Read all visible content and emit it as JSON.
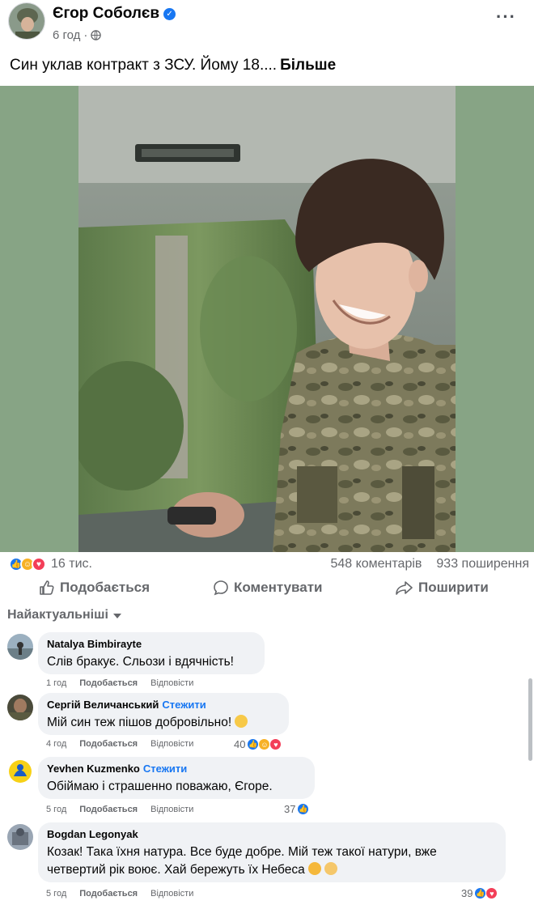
{
  "post": {
    "author": "Єгор Соболєв",
    "time": "6 год",
    "text": "Син уклав контракт з ЗСУ. Йому 18....",
    "see_more": "Більше"
  },
  "stats": {
    "reactions_count": "16 тис.",
    "comments": "548 коментарів",
    "shares": "933 поширення"
  },
  "actions": {
    "like": "Подобається",
    "comment": "Коментувати",
    "share": "Поширити"
  },
  "sort_label": "Найактуальніші",
  "comments": [
    {
      "name": "Natalya Bimbirayte",
      "follow": "",
      "text": "Слів бракує. Сльози і вдячність!",
      "time": "1 год",
      "like": "Подобається",
      "reply": "Відповісти",
      "reactions": ""
    },
    {
      "name": "Сергій Величанський",
      "follow": "Стежити",
      "text": "Мій син теж пішов добровільно!",
      "time": "4 год",
      "like": "Подобається",
      "reply": "Відповісти",
      "reactions": "40"
    },
    {
      "name": "Yevhen Kuzmenko",
      "follow": "Стежити",
      "text": "Обіймаю і страшенно поважаю, Єгоре.",
      "time": "5 год",
      "like": "Подобається",
      "reply": "Відповісти",
      "reactions": "37"
    },
    {
      "name": "Bogdan Legonyak",
      "follow": "",
      "text_line1": "Козак! Така їхня натура. Все буде добре. Мій теж такої натури, вже",
      "text_line2": "четвертий рік воює. Хай бережуть їх Небеса",
      "time": "5 год",
      "like": "Подобається",
      "reply": "Відповісти",
      "reactions": "39"
    }
  ],
  "colors": {
    "accent": "#1877f2",
    "secondary_text": "#65676b",
    "bubble": "#f0f2f5",
    "photo_background": "#87a485"
  }
}
